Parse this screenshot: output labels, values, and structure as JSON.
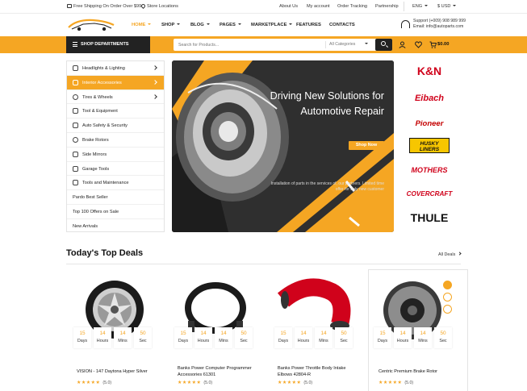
{
  "topbar": {
    "shipping": "Free Shipping On Order Over $99",
    "store_locations": "Store Locations",
    "links": [
      "About Us",
      "My account",
      "Order Tracking",
      "Partnership"
    ],
    "language": "ENG",
    "currency": "$ USD"
  },
  "logo": {
    "name": "Auto Garage",
    "tagline": "ALL CAR ACCESSORIES"
  },
  "nav": [
    "HOME",
    "SHOP",
    "BLOG",
    "PAGES",
    "MARKETPLACE",
    "FEATURES",
    "CONTACTS"
  ],
  "support": {
    "phone": "Support (+009) 908 989 999",
    "email": "Email: info@autoparts.com"
  },
  "departments_label": "SHOP DEPARTMENTS",
  "search": {
    "placeholder": "Search for Products...",
    "category": "All Categories"
  },
  "cart_total": "$0.00",
  "sidebar": [
    {
      "label": "Headlights & Lighting",
      "arrow": true
    },
    {
      "label": "Interior Accessories",
      "arrow": true,
      "active": true
    },
    {
      "label": "Tires & Wheels",
      "arrow": true
    },
    {
      "label": "Tool & Equipment",
      "arrow": false
    },
    {
      "label": "Auto Safety & Security",
      "arrow": false
    },
    {
      "label": "Brake Rotors",
      "arrow": false
    },
    {
      "label": "Side Mirrors",
      "arrow": false
    },
    {
      "label": "Garage Tools",
      "arrow": false
    },
    {
      "label": "Tools and Maintenance",
      "arrow": false
    },
    {
      "label": "Pardo Best Seller",
      "arrow": false
    },
    {
      "label": "Top 100 Offers on Sale",
      "arrow": false
    },
    {
      "label": "New Arrivals",
      "arrow": false
    }
  ],
  "hero": {
    "title_line1": "Driving New Solutions for",
    "title_line2": "Automotive Repair",
    "subtitle": "Installation of parts in the services of, our partners. Limited time offer for only new customer",
    "button": "Shop Now"
  },
  "brands": [
    "K&N",
    "Eibach",
    "Pioneer",
    "HUSKY LINERS",
    "MOTHERS",
    "COVERCRAFT",
    "THULE"
  ],
  "deals": {
    "title": "Today's Top Deals",
    "all_label": "All Deals",
    "countdown_units": [
      "Days",
      "Hours",
      "Mins",
      "Sec"
    ],
    "countdown_values": [
      "15",
      "14",
      "14",
      "50"
    ],
    "products": [
      {
        "name": "VISION - 147 Daytona Hyper Silver",
        "rating_count": "(5.0)"
      },
      {
        "name": "Banks Power Computer Programmer Accessories 61301",
        "rating_count": "(5.0)"
      },
      {
        "name": "Banks Power Throttle Body Intake Elbows 42804-R",
        "rating_count": "(5.0)"
      },
      {
        "name": "Centric Premium Brake Rotor",
        "rating_count": "(5.0)"
      }
    ],
    "stars": "★★★★★"
  },
  "colors": {
    "accent": "#f5a623",
    "dark": "#222222"
  }
}
